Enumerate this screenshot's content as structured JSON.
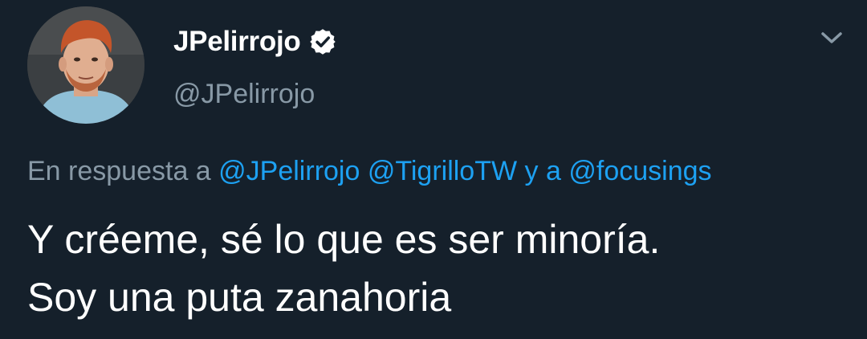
{
  "user": {
    "display_name": "JPelirrojo",
    "handle": "@JPelirrojo",
    "verified_icon": "verified-badge-icon",
    "avatar_icon": "profile-photo"
  },
  "menu": {
    "icon": "chevron-down-icon"
  },
  "reply": {
    "prefix": "En respuesta a",
    "mention_1": "@JPelirrojo",
    "mention_2": "@TigrilloTW",
    "conjunction": "y a",
    "mention_3": "@focusings"
  },
  "tweet": {
    "line_1": "Y créeme, sé lo que es ser minoría.",
    "line_2": "Soy una puta zanahoria"
  },
  "colors": {
    "background": "#15202b",
    "text": "#ffffff",
    "secondary": "#8899a6",
    "link": "#1da1f2"
  }
}
